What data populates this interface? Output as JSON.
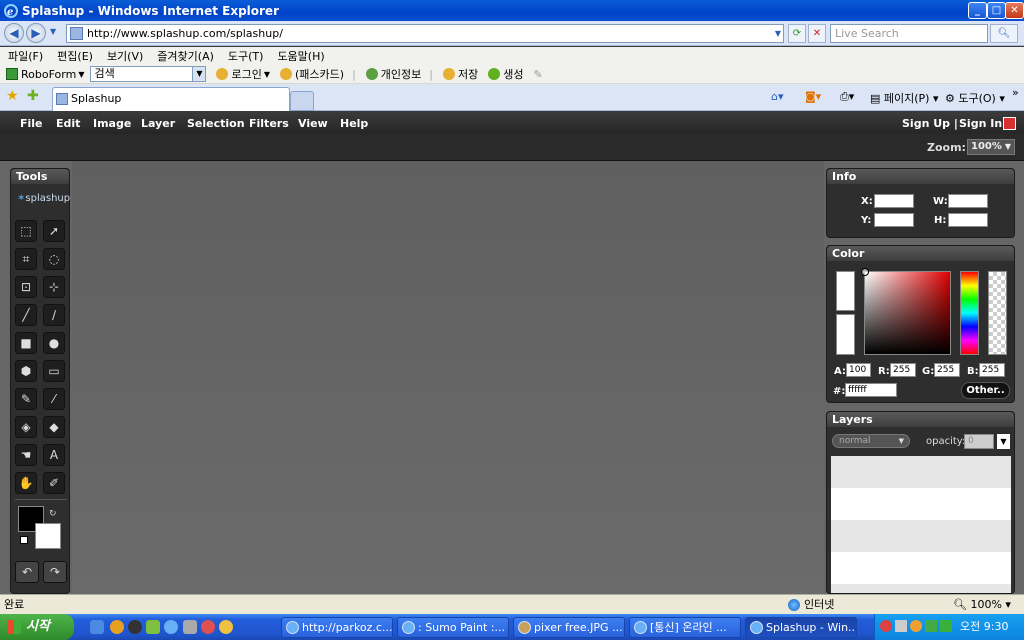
{
  "browser": {
    "title": "Splashup - Windows Internet Explorer",
    "url": "http://www.splashup.com/splashup/",
    "search_placeholder": "Live Search",
    "menu": [
      "파일(F)",
      "편집(E)",
      "보기(V)",
      "즐겨찾기(A)",
      "도구(T)",
      "도움말(H)"
    ],
    "roboform": {
      "label": "RoboForm",
      "search_value": "검색",
      "items": [
        "로그인",
        "(패스카드)",
        "개인정보",
        "저장",
        "생성"
      ]
    },
    "tab_title": "Splashup",
    "tab_tools": {
      "page": "페이지(P)",
      "tools": "도구(O)"
    }
  },
  "app": {
    "menu": [
      "File",
      "Edit",
      "Image",
      "Layer",
      "Selection",
      "Filters",
      "View",
      "Help"
    ],
    "signup": "Sign Up |",
    "signin": "Sign In",
    "zoom_label": "Zoom:",
    "zoom_value": "100%",
    "tools": {
      "title": "Tools",
      "logo": "splashup",
      "glyph_type": "A"
    },
    "info": {
      "title": "Info",
      "x": "X:",
      "y": "Y:",
      "w": "W:",
      "h": "H:"
    },
    "color": {
      "title": "Color",
      "a_label": "A:",
      "a_value": "100",
      "r_label": "R:",
      "r_value": "255",
      "g_label": "G:",
      "g_value": "255",
      "b_label": "B:",
      "b_value": "255",
      "hex_label": "#:",
      "hex_value": "ffffff",
      "other_button": "Other.."
    },
    "layers": {
      "title": "Layers",
      "blend_mode": "normal",
      "opacity_label": "opacity:",
      "opacity_value": "0"
    }
  },
  "status": {
    "text": "완료",
    "zone": "인터넷",
    "zoom": "100%"
  },
  "taskbar": {
    "start": "시작",
    "windows": [
      "http://parkoz.c...",
      ": Sumo Paint :...",
      "pixer free.JPG ...",
      "[통신] 온라인 ...",
      "Splashup - Win..."
    ],
    "clock": "오전 9:30"
  },
  "colors": {
    "title_blue": "#0042c8",
    "app_bg": "#666666",
    "panel_bg": "#2e2e2e",
    "taskbar_blue": "#245edb"
  }
}
